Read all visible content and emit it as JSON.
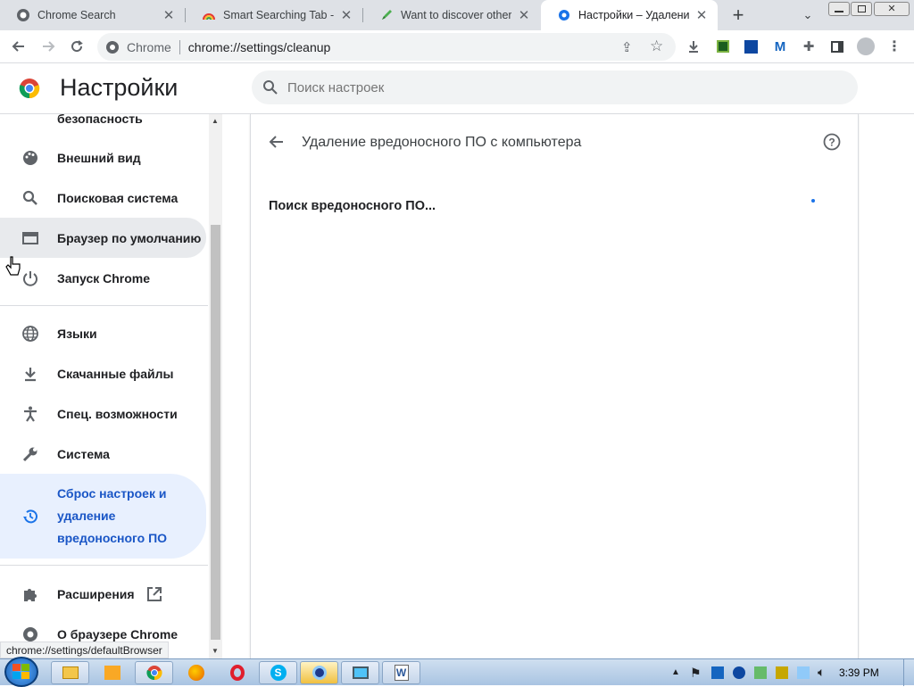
{
  "tabs": [
    {
      "title": "Chrome Search"
    },
    {
      "title": "Smart Searching Tab - Ин"
    },
    {
      "title": "Want to discover other p"
    },
    {
      "title": "Настройки – Удаление в"
    }
  ],
  "omnibox": {
    "site": "Chrome",
    "url": "chrome://settings/cleanup"
  },
  "header": {
    "title": "Настройки",
    "search_placeholder": "Поиск настроек"
  },
  "sidebar": {
    "items": [
      {
        "label": "безопасность"
      },
      {
        "label": "Внешний вид"
      },
      {
        "label": "Поисковая система"
      },
      {
        "label": "Браузер по умолчанию"
      },
      {
        "label": "Запуск Chrome"
      },
      {
        "label": "Языки"
      },
      {
        "label": "Скачанные файлы"
      },
      {
        "label": "Спец. возможности"
      },
      {
        "label": "Система"
      },
      {
        "label": "Сброс настроек и удаление вредоносного ПО"
      },
      {
        "label": "Расширения"
      },
      {
        "label": "О браузере Chrome"
      }
    ]
  },
  "main": {
    "title": "Удаление вредоносного ПО с компьютера",
    "scan_text": "Поиск вредоносного ПО..."
  },
  "status_url": "chrome://settings/defaultBrowser",
  "taskbar": {
    "clock": "3:39 PM"
  },
  "colors": {
    "accent": "#1a73e8",
    "selected_bg": "#e8f0fe"
  }
}
